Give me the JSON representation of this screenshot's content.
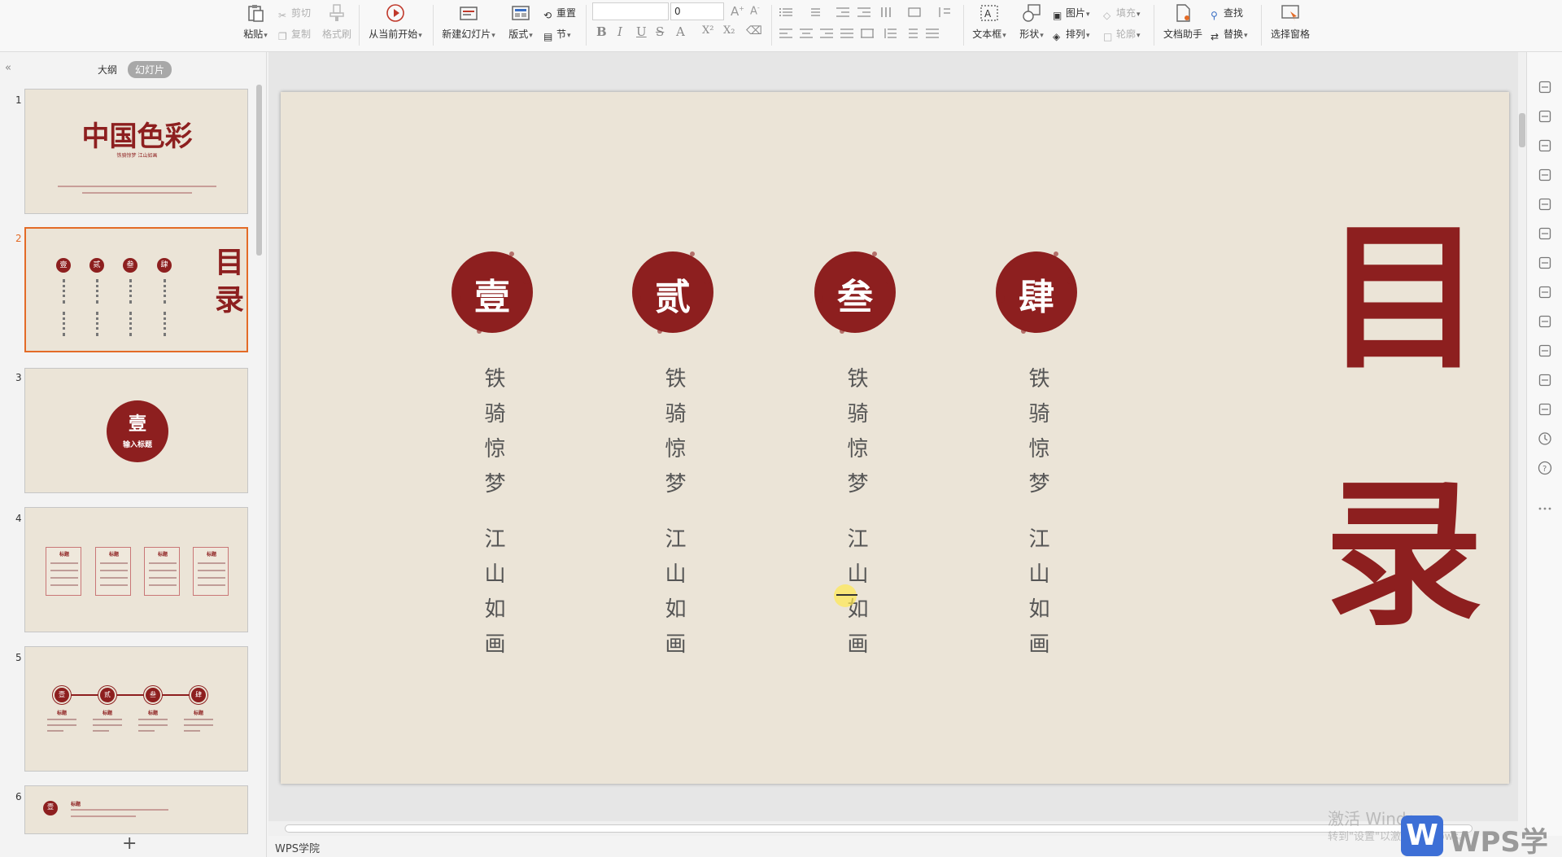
{
  "ribbon": {
    "paste": "粘贴",
    "cut": "剪切",
    "copy": "复制",
    "format_painter": "格式刷",
    "from_current": "从当前开始",
    "new_slide": "新建幻灯片",
    "layout": "版式",
    "reset": "重置",
    "section": "节",
    "font_name": "",
    "font_size": "0",
    "text_box": "文本框",
    "shape": "形状",
    "picture": "图片",
    "arrange": "排列",
    "fill": "填充",
    "outline": "轮廓",
    "doc_assistant": "文档助手",
    "find": "查找",
    "replace": "替换",
    "selection_pane": "选择窗格"
  },
  "left_panel": {
    "tab_outline": "大纲",
    "tab_slides": "幻灯片",
    "thumbs": [
      {
        "num": "1",
        "title": "中国色彩",
        "subtitle": "铁骑惊梦 江山如画"
      },
      {
        "num": "2",
        "title": "目录",
        "seals": [
          "壹",
          "贰",
          "叁",
          "肆"
        ]
      },
      {
        "num": "3",
        "seal": "壹",
        "caption": "输入标题"
      },
      {
        "num": "4",
        "card_title": "标题"
      },
      {
        "num": "5",
        "seals": [
          "壹",
          "贰",
          "叁",
          "肆"
        ],
        "label": "标题"
      },
      {
        "num": "6",
        "seal": "壹",
        "label": "标题"
      }
    ],
    "add_button": "+"
  },
  "slide": {
    "columns": [
      {
        "seal": "壹",
        "line1": "铁骑惊梦",
        "line2": "江山如画"
      },
      {
        "seal": "贰",
        "line1": "铁骑惊梦",
        "line2": "江山如画"
      },
      {
        "seal": "叁",
        "line1": "铁骑惊梦",
        "line2": "江山如画"
      },
      {
        "seal": "肆",
        "line1": "铁骑惊梦",
        "line2": "江山如画"
      }
    ],
    "title_char1": "目",
    "title_char2": "录",
    "accent_color": "#8d1f1f"
  },
  "status_bar": {
    "label": "WPS学院"
  },
  "watermark": {
    "activate_line1": "激活 Windows",
    "activate_line2": "转到\"设置\"以激活Windows。",
    "brand": "WPS学院"
  }
}
